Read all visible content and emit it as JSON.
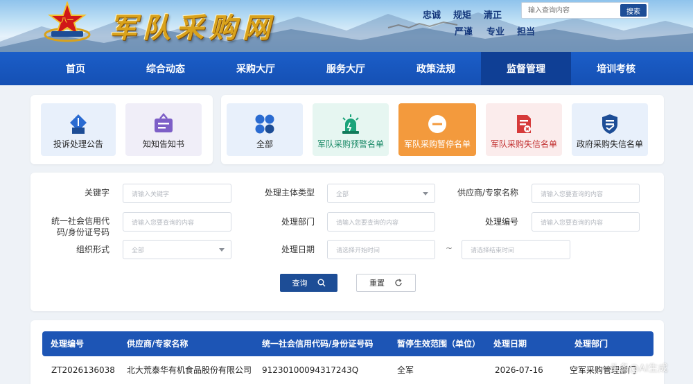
{
  "header": {
    "logo_text": "军队采购网",
    "slogans_row1": [
      "忠诚",
      "规矩",
      "清正"
    ],
    "slogans_row2": [
      "严谨",
      "专业",
      "担当"
    ],
    "search": {
      "placeholder": "输入查询内容",
      "button": "搜索"
    }
  },
  "nav": {
    "items": [
      "首页",
      "综合动态",
      "采购大厅",
      "服务大厅",
      "政策法规",
      "监督管理",
      "培训考核"
    ],
    "active": "监督管理"
  },
  "left_cards": [
    {
      "label": "投诉处理公告",
      "icon": "complaint-notice-icon"
    },
    {
      "label": "知知告知书",
      "icon": "notice-letter-icon"
    }
  ],
  "right_cards": [
    {
      "label": "全部",
      "icon": "grid-icon"
    },
    {
      "label": "军队采购预警名单",
      "icon": "alarm-light-icon"
    },
    {
      "label": "军队采购暂停名单",
      "icon": "minus-circle-icon",
      "active": true
    },
    {
      "label": "军队采购失信名单",
      "icon": "broken-document-icon"
    },
    {
      "label": "政府采购失信名单",
      "icon": "shield-document-icon"
    }
  ],
  "filters": {
    "keyword": {
      "label": "关键字",
      "placeholder": "请输入关键字"
    },
    "subject_type": {
      "label": "处理主体类型",
      "value": "全部"
    },
    "supplier": {
      "label": "供应商/专家名称",
      "placeholder": "请输入您要查询的内容"
    },
    "credit_code": {
      "label_line1": "统一社会信用代",
      "label_line2": "码/身份证号码",
      "placeholder": "请输入您要查询的内容"
    },
    "dept": {
      "label": "处理部门",
      "placeholder": "请输入您要查询的内容"
    },
    "number": {
      "label": "处理编号",
      "placeholder": "请输入您要查询的内容"
    },
    "org_form": {
      "label": "组织形式",
      "value": "全部"
    },
    "date": {
      "label": "处理日期",
      "start_placeholder": "请选择开始时间",
      "separator": "~",
      "end_placeholder": "请选择结束时间"
    },
    "query_button": "查询",
    "reset_button": "重置"
  },
  "table": {
    "columns": [
      "处理编号",
      "供应商/专家名称",
      "统一社会信用代码/身份证号码",
      "暂停生效范围（单位）",
      "处理日期",
      "处理部门"
    ],
    "rows": [
      [
        "ZT2026136038",
        "北大荒泰华有机食品股份有限公司",
        "91230100094317243Q",
        "全军",
        "2026-07-16",
        "空军采购管理部门"
      ]
    ]
  },
  "watermark": "头条@AI生成",
  "colors": {
    "nav": "#1550b4",
    "nav_active": "#0f3f95",
    "accent": "#1d4d96",
    "active_card": "#f39a3d",
    "table_head": "#1d55b5"
  }
}
